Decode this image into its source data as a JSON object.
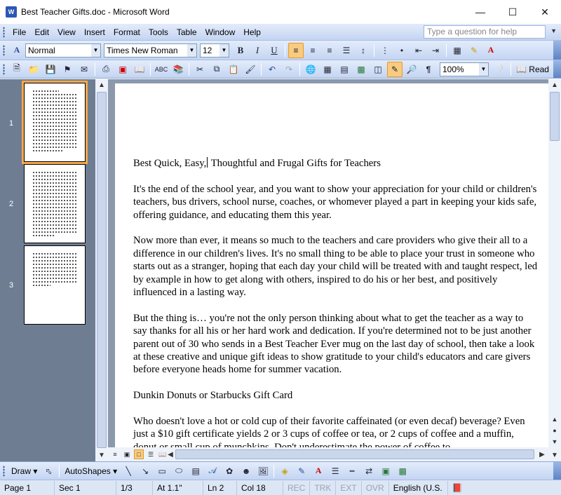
{
  "window": {
    "title": "Best Teacher Gifts.doc - Microsoft Word",
    "icon_label": "W"
  },
  "menu": {
    "items": [
      "File",
      "Edit",
      "View",
      "Insert",
      "Format",
      "Tools",
      "Table",
      "Window",
      "Help"
    ],
    "ask_placeholder": "Type a question for help"
  },
  "formatting": {
    "style": "Normal",
    "font": "Times New Roman",
    "size": "12",
    "bold": "B",
    "italic": "I",
    "underline": "U"
  },
  "standard": {
    "zoom": "100%",
    "read_label": "Read"
  },
  "thumbnails": {
    "pages": [
      "1",
      "2",
      "3"
    ],
    "selected": "1"
  },
  "document": {
    "title": "Best Quick, Easy, Thoughtful and Frugal Gifts for Teachers",
    "title_before_caret": "Best Quick, Easy,",
    "title_after_caret": " Thoughtful and Frugal Gifts for Teachers",
    "paragraphs": [
      "It's the end of the school year, and you want to show your appreciation for your child or children's teachers, bus drivers, school nurse, coaches, or whomever played a part in keeping your kids safe, offering guidance, and educating them this year.",
      "Now more than ever, it means so much to the teachers and care providers who give their all to a difference in our children's lives. It's no small thing to be able to place your trust in someone who starts out as a stranger, hoping that each day your child will be treated with and taught respect, led by example in how to get along with others, inspired to do his or her best, and positively influenced in a lasting way.",
      "But the thing is… you're not the only person thinking about what to get the teacher as a way to say thanks for all his or her hard work and dedication. If you're determined not to be just another parent out of 30 who sends in a Best Teacher Ever mug on the last day of school, then take a look at these creative and unique gift ideas to show gratitude to your child's educators and care givers before everyone heads home for summer vacation.",
      "Dunkin Donuts or Starbucks Gift Card",
      "Who doesn't love a hot or cold cup of their favorite caffeinated (or even decaf) beverage? Even just a $10 gift certificate yields 2 or 3 cups of coffee or tea, or 2 cups of coffee and a muffin, donut or small cup of munchkins. Don't underestimate the power of coffee to"
    ]
  },
  "drawing": {
    "draw_label": "Draw",
    "autoshapes_label": "AutoShapes"
  },
  "status": {
    "page": "Page 1",
    "section": "Sec 1",
    "page_of": "1/3",
    "at": "At 1.1\"",
    "line": "Ln 2",
    "col": "Col 18",
    "rec": "REC",
    "trk": "TRK",
    "ext": "EXT",
    "ovr": "OVR",
    "language": "English (U.S."
  }
}
